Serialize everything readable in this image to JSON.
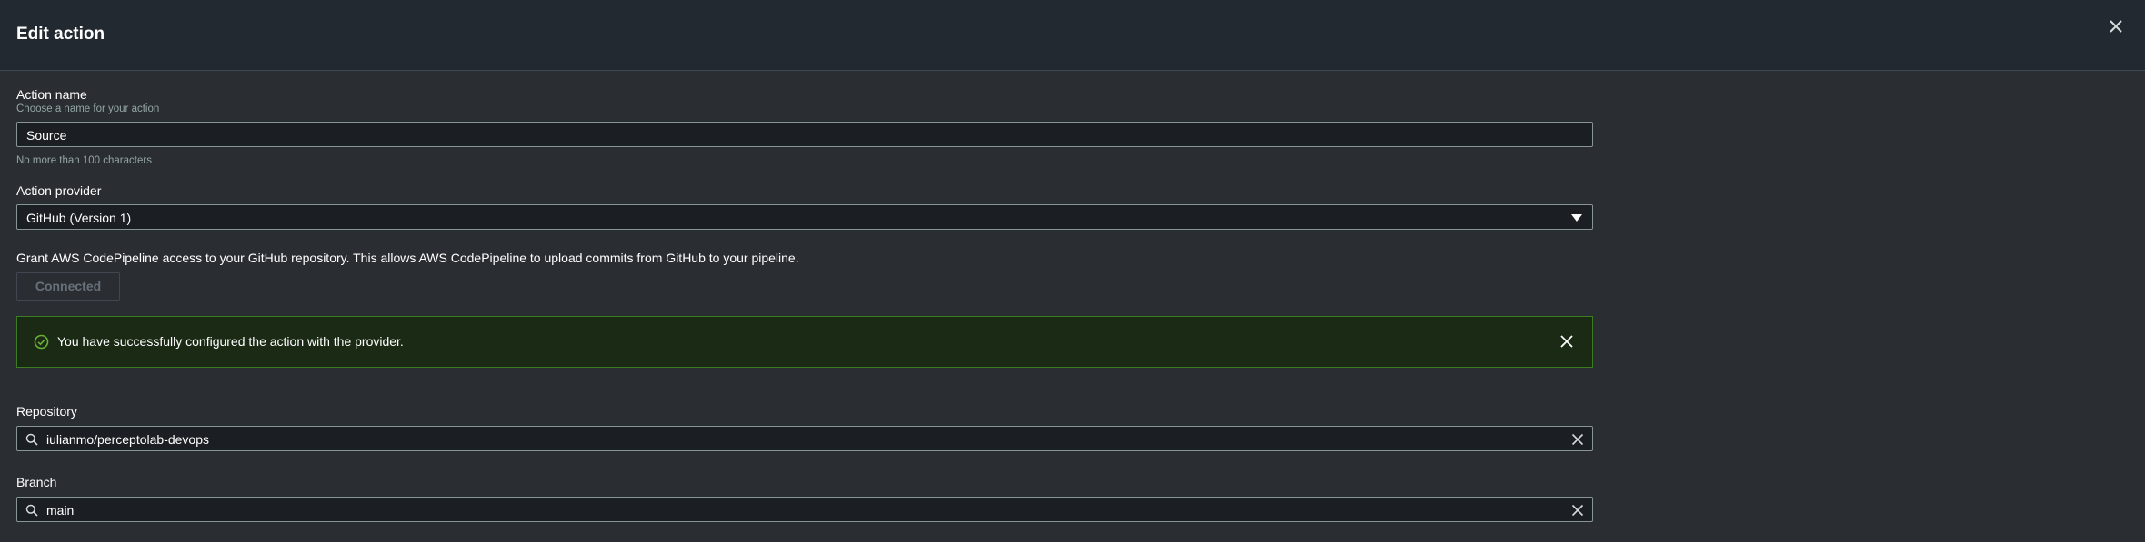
{
  "modal": {
    "title": "Edit action"
  },
  "action_name": {
    "label": "Action name",
    "description": "Choose a name for your action",
    "value": "Source",
    "constraint": "No more than 100 characters"
  },
  "action_provider": {
    "label": "Action provider",
    "selected": "GitHub (Version 1)"
  },
  "grant": {
    "text": "Grant AWS CodePipeline access to your GitHub repository. This allows AWS CodePipeline to upload commits from GitHub to your pipeline.",
    "button_label": "Connected"
  },
  "alert": {
    "message": "You have successfully configured the action with the provider.",
    "color": "#3b7b21"
  },
  "repository": {
    "label": "Repository",
    "value": "iulianmo/perceptolab-devops"
  },
  "branch": {
    "label": "Branch",
    "value": "main"
  }
}
